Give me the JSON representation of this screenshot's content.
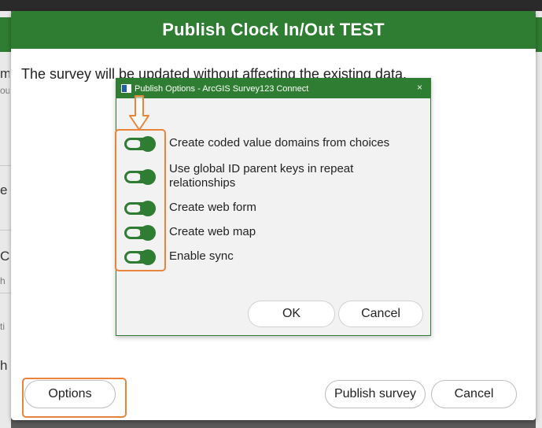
{
  "main_dialog": {
    "title": "Publish Clock In/Out TEST",
    "message": "The survey will be updated without affecting the existing data.",
    "options_button": "Options",
    "publish_button": "Publish survey",
    "cancel_button": "Cancel"
  },
  "publish_options": {
    "title": "Publish Options - ArcGIS Survey123 Connect",
    "close_glyph": "×",
    "items": [
      {
        "label": "Create coded value domains from choices",
        "checked": true
      },
      {
        "label": "Use global ID parent keys in repeat relationships",
        "checked": true
      },
      {
        "label": "Create web form",
        "checked": true
      },
      {
        "label": "Create web map",
        "checked": true
      },
      {
        "label": "Enable sync",
        "checked": true
      }
    ],
    "ok_button": "OK",
    "cancel_button": "Cancel"
  },
  "background_fragments": [
    "m",
    "ou",
    "e",
    "C",
    "h",
    "ti",
    "h"
  ],
  "colors": {
    "header_green": "#2f7d32",
    "highlight_orange": "#e8853a",
    "toggle_on": "#2f7d32"
  }
}
